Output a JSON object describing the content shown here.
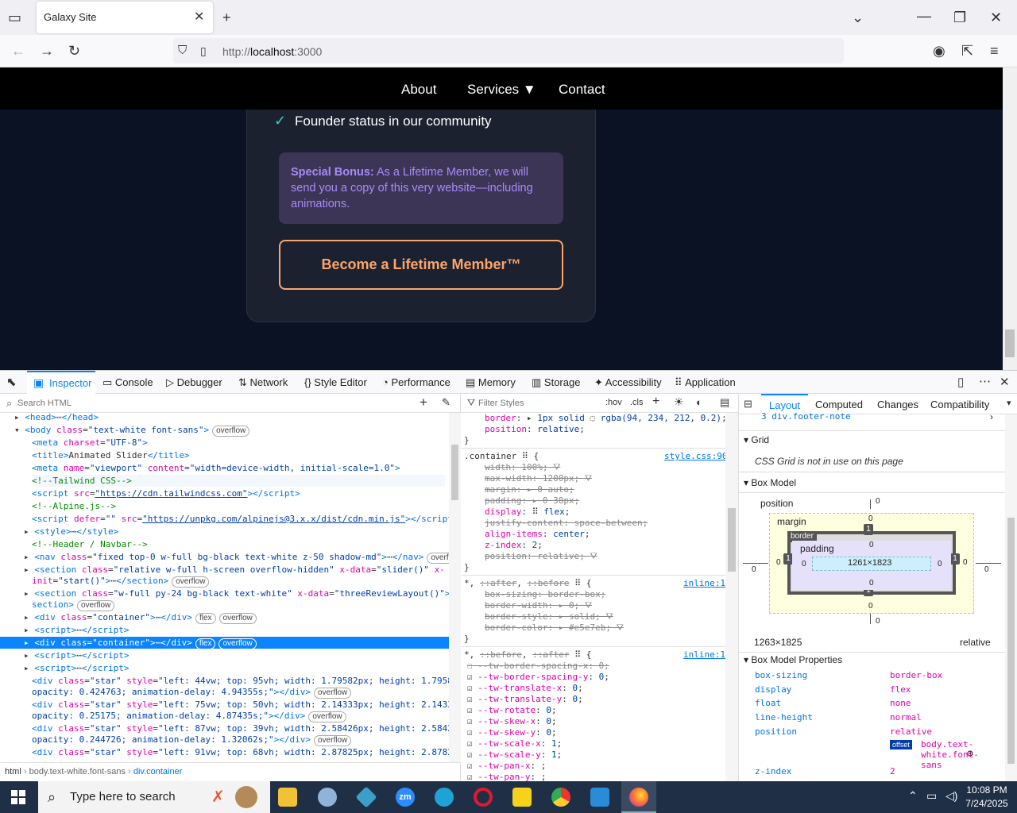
{
  "browser": {
    "tab_title": "Galaxy Site",
    "url_prefix": "http://",
    "url_host": "localhost",
    "url_port": ":3000"
  },
  "site": {
    "nav": [
      "About",
      "Services ▼",
      "Contact"
    ],
    "feature_item": "Founder status in our community",
    "bonus_label": "Special Bonus:",
    "bonus_text": " As a Lifetime Member, we will send you a copy of this very website—including animations.",
    "cta_label": "Become a Lifetime Member™"
  },
  "devtools": {
    "tabs": [
      "Inspector",
      "Console",
      "Debugger",
      "Network",
      "Style Editor",
      "Performance",
      "Memory",
      "Storage",
      "Accessibility",
      "Application"
    ],
    "search_placeholder": "Search HTML",
    "filter_placeholder": "Filter Styles",
    "hov": ":hov",
    "cls": ".cls",
    "layout_tabs": [
      "Layout",
      "Computed",
      "Changes",
      "Compatibility"
    ],
    "breadcrumb": [
      "html",
      "body.text-white.font-sans",
      "div.container"
    ],
    "grid_heading": "Grid",
    "grid_note": "CSS Grid is not in use on this page",
    "boxmodel_heading": "Box Model",
    "boxmodel_props_heading": "Box Model Properties",
    "footer_note_row": "3  div.footer-note",
    "box": {
      "position_label": "position",
      "margin_label": "margin",
      "border_label": "border",
      "padding_label": "padding",
      "content": "1261×1823",
      "size": "1263×1825",
      "pos_value": "relative"
    },
    "props": [
      {
        "k": "box-sizing",
        "v": "border-box"
      },
      {
        "k": "display",
        "v": "flex"
      },
      {
        "k": "float",
        "v": "none"
      },
      {
        "k": "line-height",
        "v": "normal"
      },
      {
        "k": "position",
        "v": "relative"
      },
      {
        "k": "z-index",
        "v": "2"
      }
    ],
    "offset_badge": "offset",
    "offset_target": "body.text-white.font-sans"
  },
  "taskbar": {
    "search_text": "Type here to search",
    "time": "10:08 PM",
    "date": "7/24/2025"
  },
  "colors": {
    "accent": "#fba56a",
    "bonus_text": "#a78bfa",
    "check": "#2dd4bf",
    "selection": "#0a84ff"
  }
}
